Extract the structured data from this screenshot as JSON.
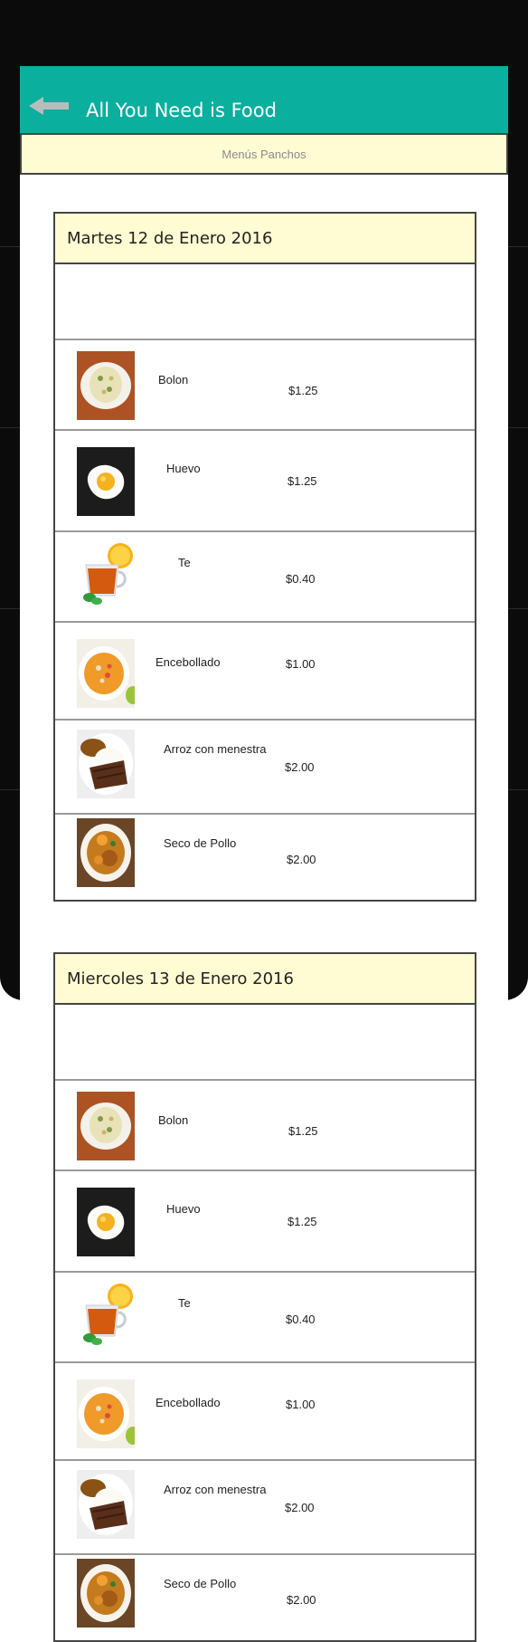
{
  "app": {
    "title": "All You Need is Food",
    "subheader": "Menús Panchos"
  },
  "icons": {
    "back": "back-arrow-icon"
  },
  "colors": {
    "app_bar": "#0aaf9e",
    "header_bg": "#fffcd3",
    "frame": "#0b0b0b"
  },
  "days": [
    {
      "title": "Martes 12 de Enero 2016",
      "items": [
        {
          "name": "Bolon",
          "price": "$1.25",
          "image": "bolon-image"
        },
        {
          "name": "Huevo",
          "price": "$1.25",
          "image": "fried-egg-image"
        },
        {
          "name": "Te",
          "price": "$0.40",
          "image": "tea-cup-image"
        },
        {
          "name": "Encebollado",
          "price": "$1.00",
          "image": "encebollado-soup-image"
        },
        {
          "name": "Arroz con menestra",
          "price": "$2.00",
          "image": "arroz-menestra-image"
        },
        {
          "name": "Seco de Pollo",
          "price": "$2.00",
          "image": "seco-de-pollo-image"
        }
      ]
    },
    {
      "title": "Miercoles 13 de Enero 2016",
      "items": [
        {
          "name": "Bolon",
          "price": "$1.25",
          "image": "bolon-image"
        },
        {
          "name": "Huevo",
          "price": "$1.25",
          "image": "fried-egg-image"
        },
        {
          "name": "Te",
          "price": "$0.40",
          "image": "tea-cup-image"
        },
        {
          "name": "Encebollado",
          "price": "$1.00",
          "image": "encebollado-soup-image"
        },
        {
          "name": "Arroz con menestra",
          "price": "$2.00",
          "image": "arroz-menestra-image"
        },
        {
          "name": "Seco de Pollo",
          "price": "$2.00",
          "image": "seco-de-pollo-image"
        }
      ]
    }
  ]
}
